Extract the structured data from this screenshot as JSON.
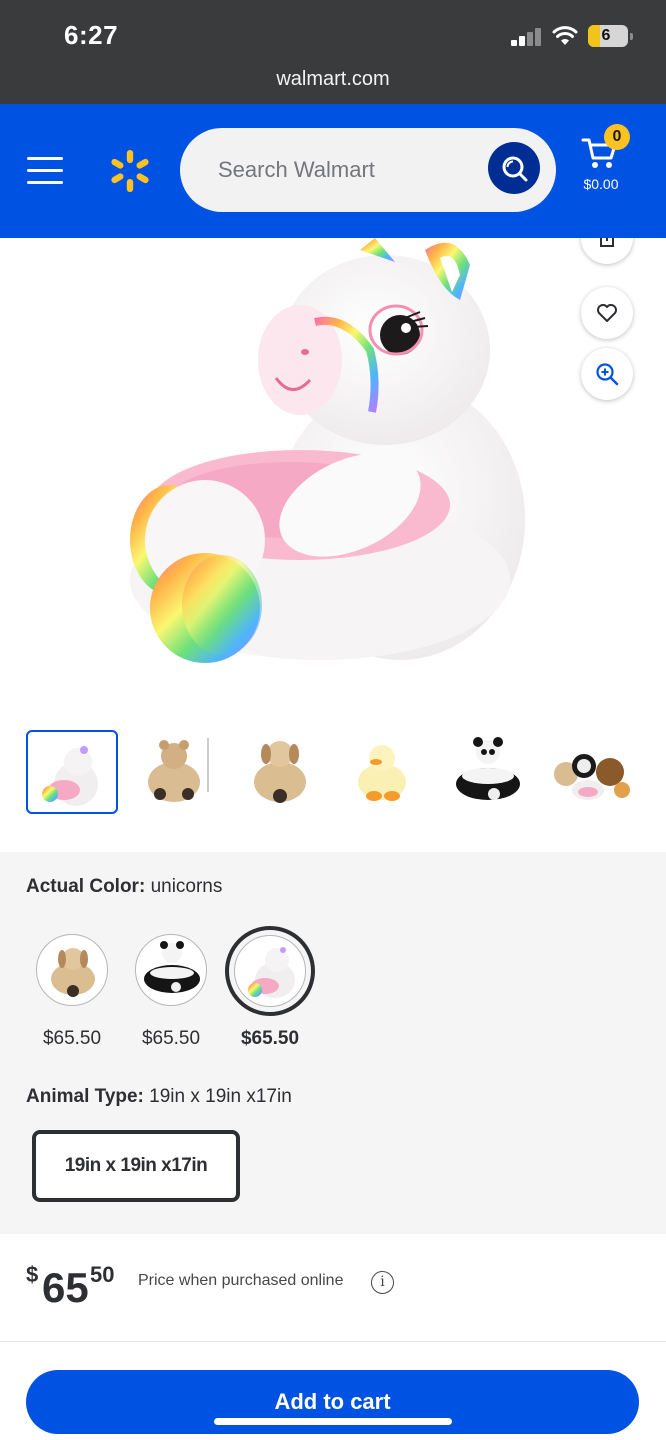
{
  "status_bar": {
    "time": "6:27",
    "battery": "6",
    "url": "walmart.com"
  },
  "header": {
    "search_placeholder": "Search Walmart",
    "cart_count": "0",
    "cart_total": "$0.00",
    "brand_color": "#0053e2",
    "spark_color": "#ffc220"
  },
  "icons": {
    "menu": "hamburger-icon",
    "logo": "walmart-spark-icon",
    "search": "search-icon",
    "cart": "cart-icon",
    "share": "share-icon",
    "favorite": "heart-icon",
    "zoom": "zoom-in-icon",
    "info": "info-icon"
  },
  "product": {
    "thumbnail_count": 6,
    "selected_thumbnail": 1,
    "actual_color_label": "Actual Color:",
    "actual_color_value": "unicorns",
    "swatches": [
      {
        "price": "$65.50",
        "selected": false
      },
      {
        "price": "$65.50",
        "selected": false
      },
      {
        "price": "$65.50",
        "selected": true
      }
    ],
    "animal_type_label": "Animal Type:",
    "animal_type_value": "19in x 19in x17in",
    "size_option": "19in x 19in x17in",
    "price_currency": "$",
    "price_dollars": "65",
    "price_cents": "50",
    "price_note": "Price when purchased online",
    "info_glyph": "i"
  },
  "actions": {
    "add_to_cart": "Add to cart"
  }
}
